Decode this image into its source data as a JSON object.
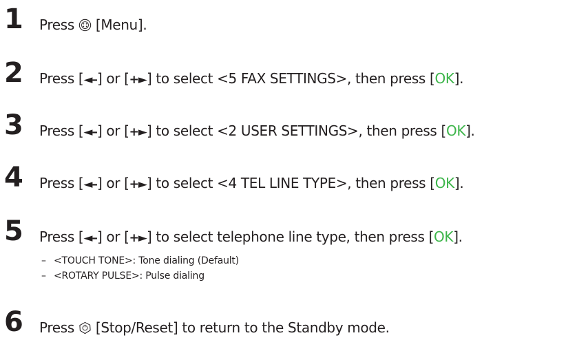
{
  "steps": [
    {
      "number": "1",
      "pre": "Press ",
      "post": " [Menu]."
    },
    {
      "number": "2",
      "pre": "Press [",
      "left_arrows": "◄–",
      "mid": "] or [",
      "right_arrows": "+►",
      "after": "] to select <5 FAX SETTINGS>, then press [",
      "ok": "OK",
      "end": "]."
    },
    {
      "number": "3",
      "pre": "Press [",
      "left_arrows": "◄–",
      "mid": "] or [",
      "right_arrows": "+►",
      "after": "] to select <2 USER SETTINGS>, then press [",
      "ok": "OK",
      "end": "]."
    },
    {
      "number": "4",
      "pre": "Press [",
      "left_arrows": "◄–",
      "mid": "] or [",
      "right_arrows": "+►",
      "after": "] to select <4 TEL LINE TYPE>, then press [",
      "ok": "OK",
      "end": "]."
    },
    {
      "number": "5",
      "pre": "Press [",
      "left_arrows": "◄–",
      "mid": "] or [",
      "right_arrows": "+►",
      "after": "] to select telephone line type, then press [",
      "ok": "OK",
      "end": "].",
      "options": [
        {
          "dash": "–",
          "text": "<TOUCH TONE>: Tone dialing (Default)"
        },
        {
          "dash": "–",
          "text": "<ROTARY PULSE>: Pulse dialing"
        }
      ]
    },
    {
      "number": "6",
      "pre": "Press ",
      "post": " [Stop/Reset] to return to the Standby mode."
    }
  ],
  "colors": {
    "text": "#231f20",
    "ok": "#3db54a"
  },
  "icons": {
    "menu": "menu-key-icon",
    "stop": "stop-reset-key-icon"
  }
}
